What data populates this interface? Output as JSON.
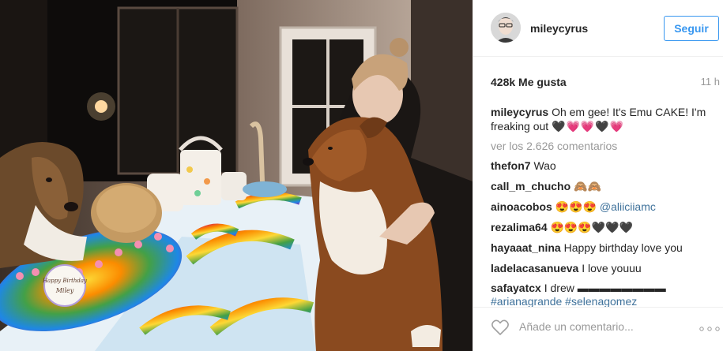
{
  "post": {
    "username": "mileycyrus",
    "follow_label": "Seguir",
    "likes": "428k Me gusta",
    "time": "11 h",
    "caption_user": "mileycyrus",
    "caption_text": "Oh em gee! It's Emu CAKE! I'm freaking out",
    "caption_hearts": "🖤💗💗🖤💗",
    "view_all": "ver los 2.626 comentarios",
    "comments": [
      {
        "user": "thefon7",
        "text": "Wao"
      },
      {
        "user": "call_m_chucho",
        "text": "🙈🙈"
      },
      {
        "user": "ainoacobos",
        "text": "😍😍😍",
        "mention": "@aliiciiamc"
      },
      {
        "user": "rezalima64",
        "text": "😍😍😍🖤🖤🖤"
      },
      {
        "user": "hayaaat_nina",
        "text": "Happy birthday love you"
      },
      {
        "user": "ladelacasanueva",
        "text": "I love youuu"
      },
      {
        "user": "safayatcx",
        "text": "I drew ▬▬▬▬▬▬▬▬",
        "mention": "#arianagrande #selenagomez"
      }
    ],
    "add_comment_placeholder": "Añade un comentario...",
    "cake_topper_text": "Happy Birthday Miley"
  },
  "icons": {
    "like": "heart-outline-icon",
    "more": "more-options-icon"
  },
  "colors": {
    "link": "#3897f0",
    "mention": "#3f729b",
    "muted": "#999999"
  }
}
